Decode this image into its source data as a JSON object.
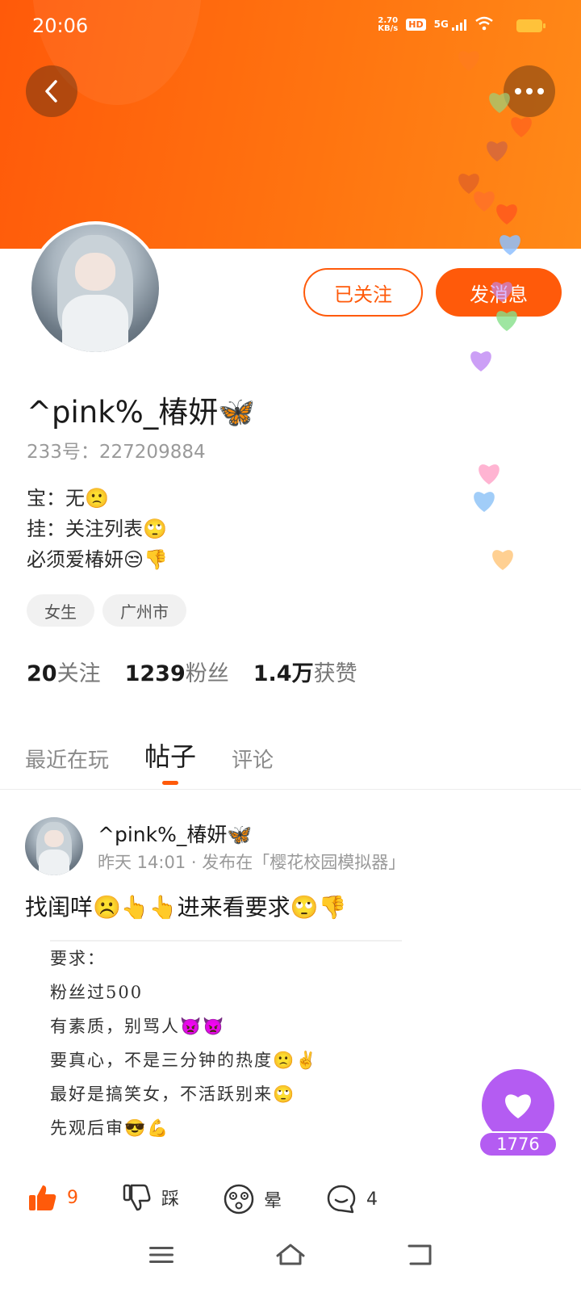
{
  "status_bar": {
    "time": "20:06",
    "network_speed_value": "2.70",
    "network_speed_unit": "KB/s",
    "hd": "HD",
    "signal": "5G"
  },
  "header": {
    "back_icon": "chevron-left-icon",
    "more_icon": "more-dots-icon"
  },
  "profile": {
    "nickname": "^pink%_椿妍🦋",
    "uid": "233号：227209884",
    "follow_button": "已关注",
    "message_button": "发消息",
    "bio": [
      "宝：无🙁",
      "挂：关注列表🙄",
      "必须爱椿妍😒👎"
    ],
    "tags": [
      "女生",
      "广州市"
    ],
    "stats": [
      {
        "num": "20",
        "label": "关注"
      },
      {
        "num": "1239",
        "label": "粉丝"
      },
      {
        "num": "1.4万",
        "label": "获赞"
      }
    ]
  },
  "tabs": [
    {
      "label": "最近在玩",
      "active": false
    },
    {
      "label": "帖子",
      "active": true
    },
    {
      "label": "评论",
      "active": false
    }
  ],
  "post": {
    "author": "^pink%_椿妍🦋",
    "meta": "昨天 14:01 · 发布在「樱花校园模拟器」",
    "title": "找闺咩☹️👆👆进来看要求🙄👎",
    "image_lines": [
      "要求：",
      "粉丝过500",
      "有素质，别骂人👿👿",
      "要真心，不是三分钟的热度🙁✌️",
      "最好是搞笑女，不活跃别来🙄",
      "先观后审😎💪"
    ],
    "like_count": "9",
    "dislike_label": "踩",
    "dizzy_label": "晕",
    "comment_count": "4"
  },
  "heart_fab": {
    "count": "1776",
    "color": "#b45cf2"
  },
  "colors": {
    "accent": "#ff5a0a",
    "banner": "#ff6e10"
  }
}
